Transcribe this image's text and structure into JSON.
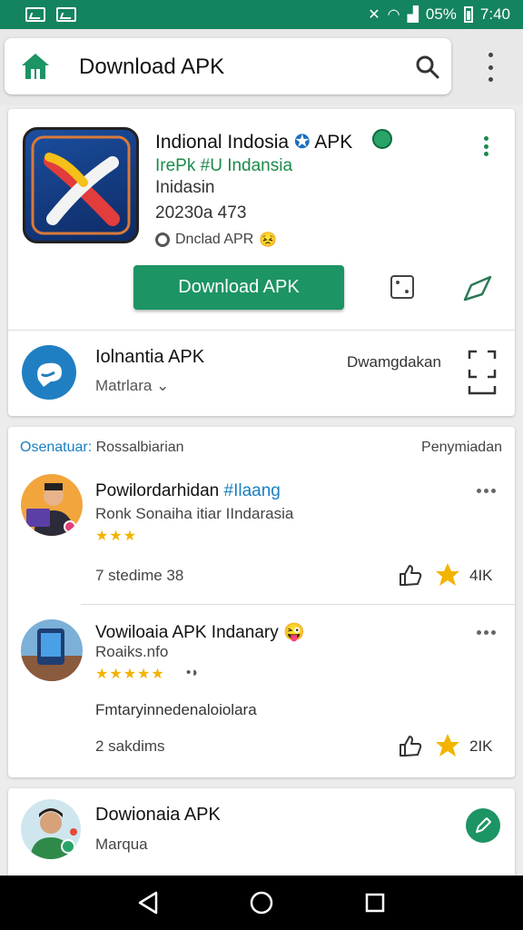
{
  "status_bar": {
    "battery_text": "05%",
    "time": "7:40"
  },
  "app_bar": {
    "title": "Download APK"
  },
  "app": {
    "title": "Indional Indosia",
    "title_suffix": "APK",
    "developer": "IrePk #U Indansia",
    "category": "Inidasin",
    "version": "20230a 473",
    "size_label": "Dnclad APR",
    "download_label": "Download APK"
  },
  "sub_item": {
    "title": "Iolnantia APK",
    "meta": "Matrlara",
    "action": "Dwamgdakan"
  },
  "reviews": {
    "header_accent": "Osenatuar:",
    "header_rest": "Rossalbiarian",
    "header_right": "Penymiadan",
    "items": [
      {
        "name": "Powilordarhidan",
        "name_accent": "#Ilaang",
        "subtitle": "Ronk Sonaiha itiar IIndarasia",
        "stars": "★★★",
        "text": "",
        "time": "7 stedime 38",
        "count": "4IK"
      },
      {
        "name": "Vowiloaia APK Indanary",
        "name_accent": "",
        "subtitle": "Roaiks.nfo",
        "stars": "★★★★★",
        "text": "Fmtaryinnedenaloiolara",
        "time": "2 sakdims",
        "count": "2IK"
      }
    ]
  },
  "bottom_item": {
    "title": "Dowionaia APK",
    "subtitle": "Marqua"
  },
  "colors": {
    "brand_green": "#14835f",
    "button_green": "#1c9463",
    "star_yellow": "#f2b400",
    "accent_blue": "#1a7fc0"
  },
  "icons": [
    "home-icon",
    "search-icon",
    "overflow-icon",
    "dice-icon",
    "share-icon",
    "expand-icon",
    "thumb-up-icon",
    "star-icon",
    "back-icon",
    "home-circle-icon",
    "recents-icon"
  ]
}
